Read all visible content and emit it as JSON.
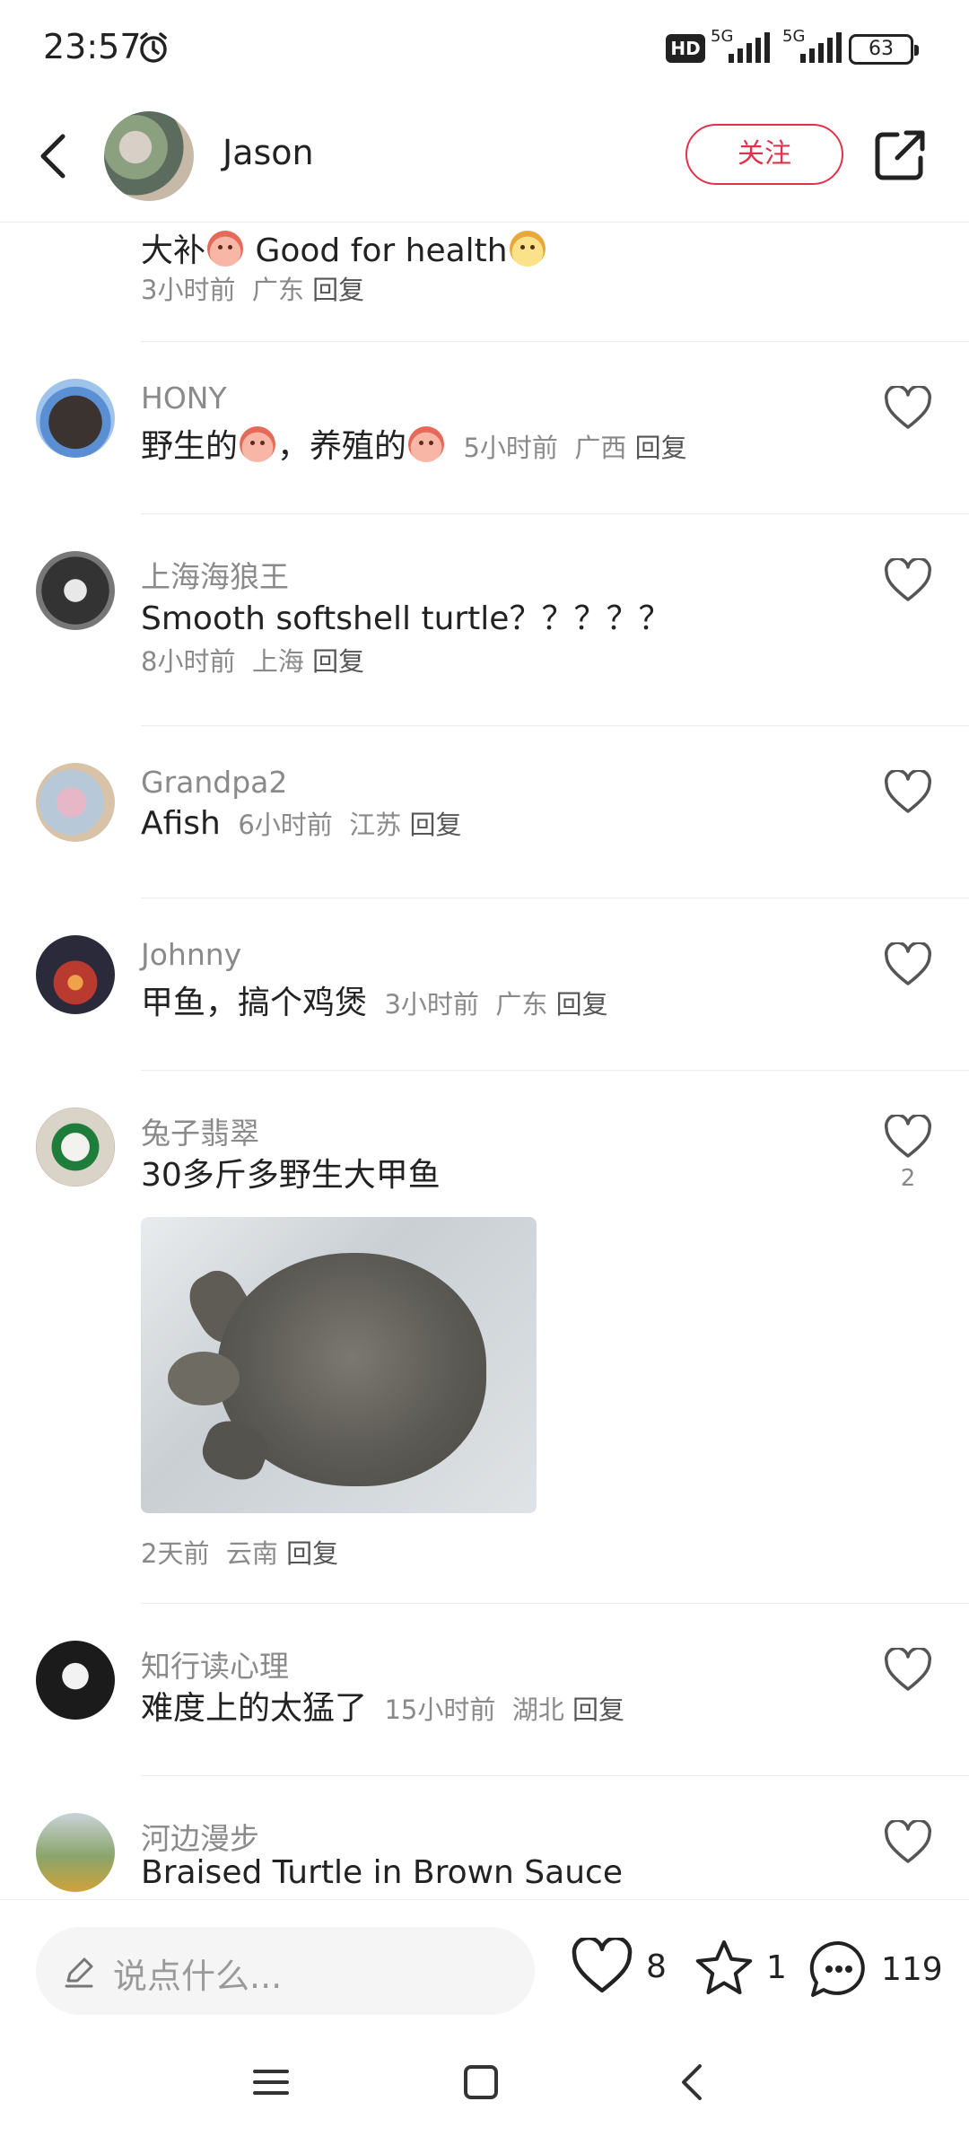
{
  "status_bar": {
    "time": "23:57",
    "hd_label": "HD",
    "net1": "5G",
    "net2": "5G",
    "battery": "63"
  },
  "header": {
    "author_name": "Jason",
    "follow_label": "关注"
  },
  "comments": [
    {
      "username": "",
      "text": "大补",
      "text2": "Good for health",
      "meta_time": "3小时前",
      "meta_region": "广东",
      "reply": "回复"
    },
    {
      "username": "HONY",
      "text": "野生的",
      "text2": "，养殖的",
      "meta_time": "5小时前",
      "meta_region": "广西",
      "reply": "回复"
    },
    {
      "username": "上海海狼王",
      "text": "Smooth softshell turtle？？？？？",
      "meta_time": "8小时前",
      "meta_region": "上海",
      "reply": "回复"
    },
    {
      "username": "Grandpa2",
      "text": "Afish",
      "meta_time": "6小时前",
      "meta_region": "江苏",
      "reply": "回复"
    },
    {
      "username": "Johnny",
      "text": "甲鱼，搞个鸡煲",
      "meta_time": "3小时前",
      "meta_region": "广东",
      "reply": "回复"
    },
    {
      "username": "兔子翡翠",
      "text": "30多斤多野生大甲鱼",
      "meta_time": "2天前",
      "meta_region": "云南",
      "reply": "回复",
      "likes": "2"
    },
    {
      "username": "知行读心理",
      "text": "难度上的太猛了",
      "meta_time": "15小时前",
      "meta_region": "湖北",
      "reply": "回复"
    },
    {
      "username": "河边漫步",
      "text": "Braised Turtle in Brown Sauce"
    }
  ],
  "bottom_bar": {
    "placeholder": "说点什么...",
    "like_count": "8",
    "star_count": "1",
    "comment_count": "119"
  },
  "colors": {
    "accent": "#e0324b",
    "muted": "#8a8a8a"
  }
}
